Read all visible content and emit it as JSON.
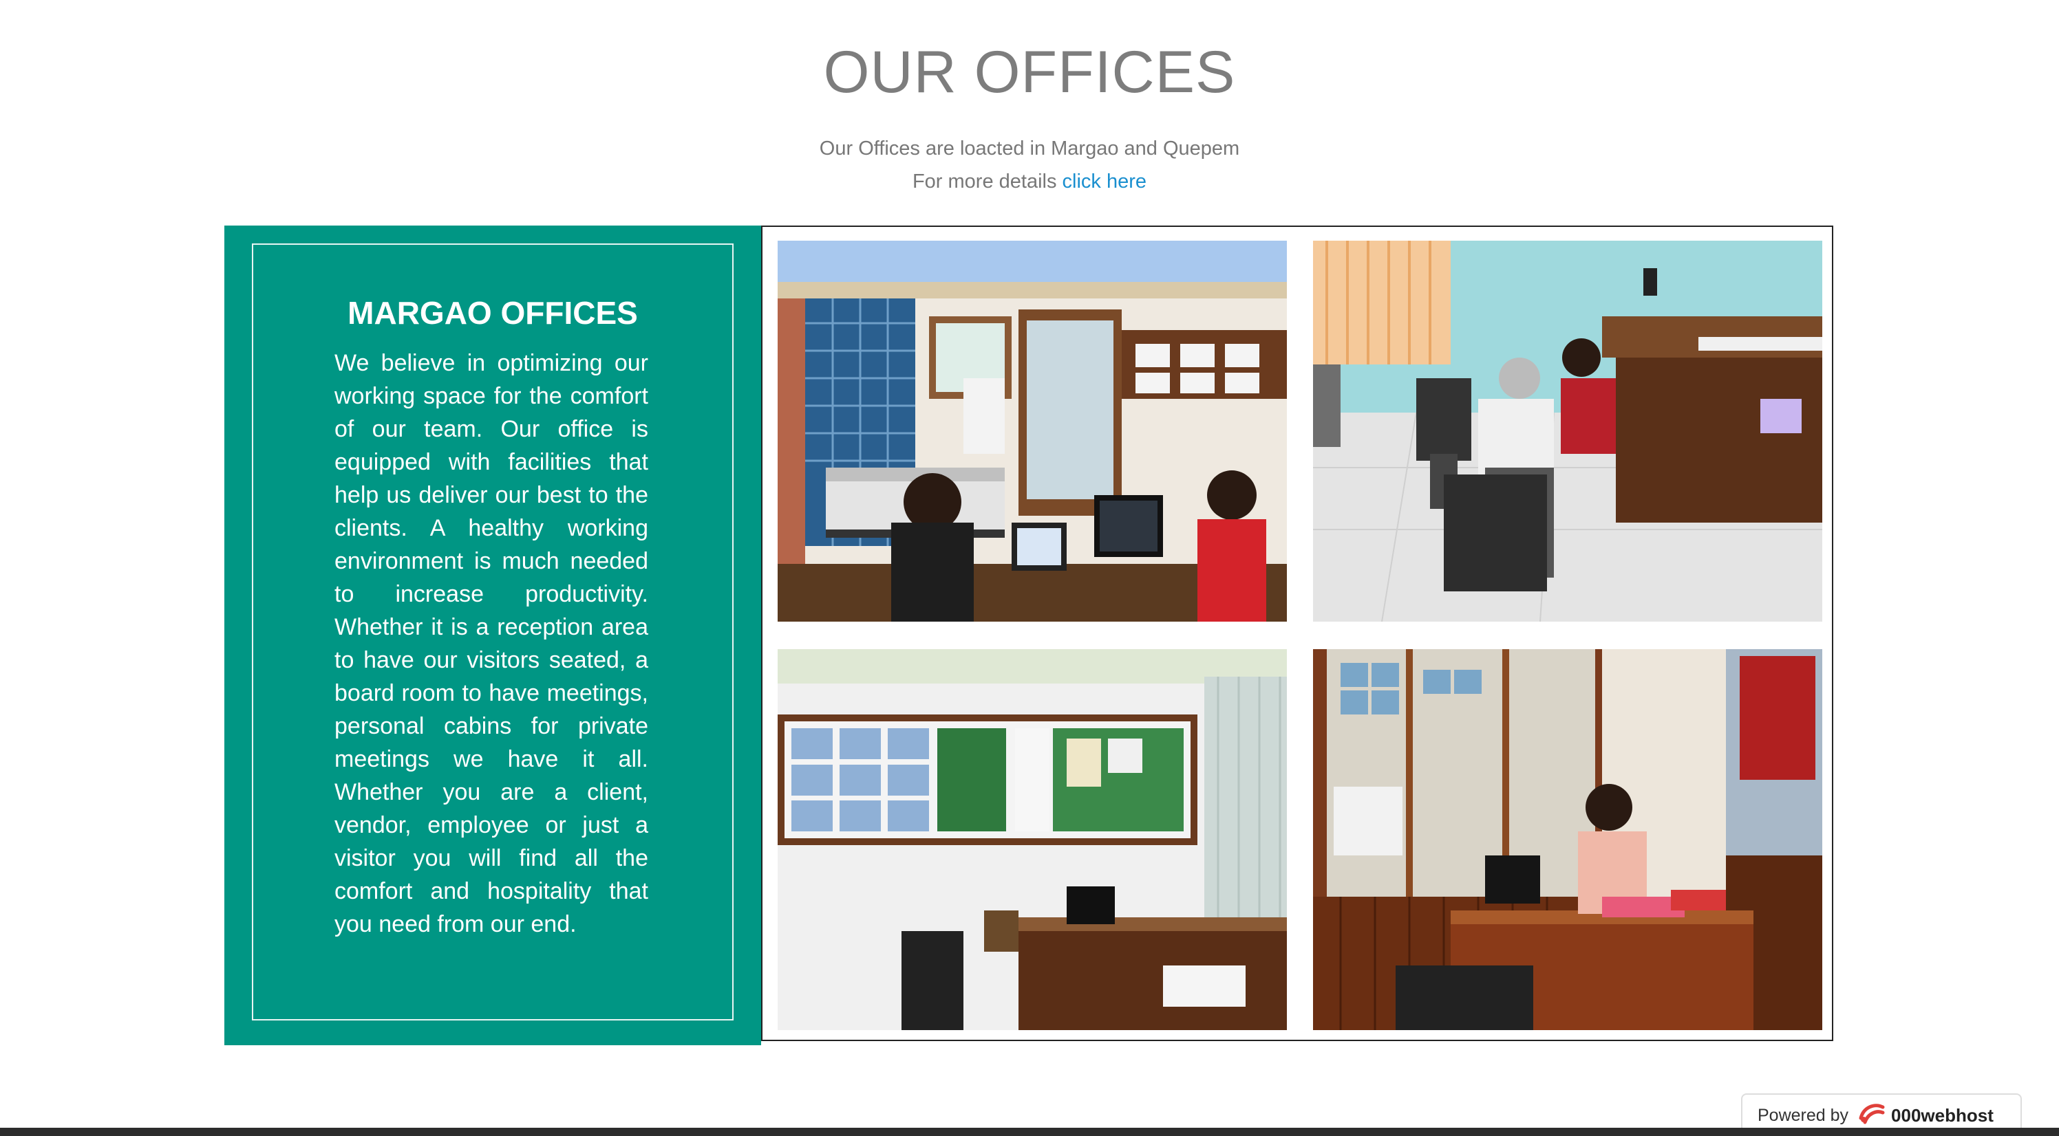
{
  "section": {
    "title": "OUR OFFICES",
    "intro_line1": "Our Offices are loacted in Margao and Quepem",
    "intro_line2_prefix": "For more details",
    "intro_link": "click here"
  },
  "panel": {
    "title": "MARGAO OFFICES",
    "text": "We believe in optimizing our working space for the comfort of our team. Our office is equipped with facilities that help us deliver our best to the clients. A healthy working environment is much needed to increase productivity. Whether it is a reception area to have our visitors seated, a board room to have meetings, personal cabins for private meetings we have it all. Whether you are a client, vendor, employee or just a visitor you will find all the comfort and hospitality that you need from our end."
  },
  "colors": {
    "panel_bg": "#009684",
    "link": "#1a8fcf",
    "title": "#7d7d7d"
  },
  "footer": {
    "powered_label": "Powered by",
    "brand": "000webhost"
  }
}
